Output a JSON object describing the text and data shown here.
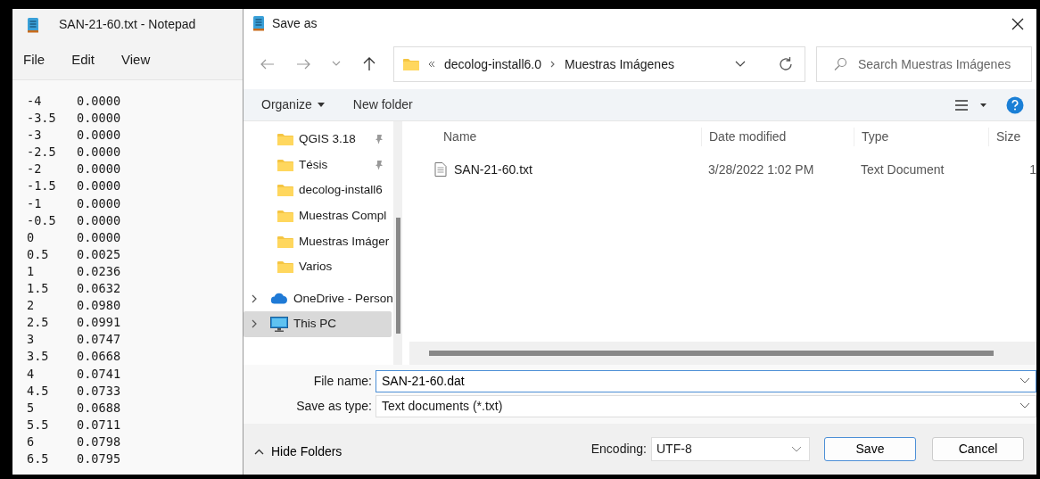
{
  "notepad": {
    "title": "SAN-21-60.txt - Notepad",
    "menu": [
      "File",
      "Edit",
      "View"
    ],
    "lines": [
      [
        "-4",
        "0.0000"
      ],
      [
        "-3.5",
        "0.0000"
      ],
      [
        "-3",
        "0.0000"
      ],
      [
        "-2.5",
        "0.0000"
      ],
      [
        "-2",
        "0.0000"
      ],
      [
        "-1.5",
        "0.0000"
      ],
      [
        "-1",
        "0.0000"
      ],
      [
        "-0.5",
        "0.0000"
      ],
      [
        "0",
        "0.0000"
      ],
      [
        "0.5",
        "0.0025"
      ],
      [
        "1",
        "0.0236"
      ],
      [
        "1.5",
        "0.0632"
      ],
      [
        "2",
        "0.0980"
      ],
      [
        "2.5",
        "0.0991"
      ],
      [
        "3",
        "0.0747"
      ],
      [
        "3.5",
        "0.0668"
      ],
      [
        "4",
        "0.0741"
      ],
      [
        "4.5",
        "0.0733"
      ],
      [
        "5",
        "0.0688"
      ],
      [
        "5.5",
        "0.0711"
      ],
      [
        "6",
        "0.0798"
      ],
      [
        "6.5",
        "0.0795"
      ]
    ]
  },
  "dialog": {
    "title": "Save as",
    "breadcrumb": [
      "decolog-install6.0",
      "Muestras Imágenes"
    ],
    "search": {
      "placeholder": "Search Muestras Imágenes"
    },
    "toolbar": {
      "organize": "Organize",
      "new_folder": "New folder"
    },
    "nav_items": [
      {
        "label": "QGIS 3.18",
        "kind": "folder",
        "pinned": true,
        "expandable": false,
        "selected": false
      },
      {
        "label": "Tésis",
        "kind": "folder",
        "pinned": true,
        "expandable": false,
        "selected": false
      },
      {
        "label": "decolog-install6",
        "kind": "folder",
        "pinned": false,
        "expandable": false,
        "selected": false
      },
      {
        "label": "Muestras Compl",
        "kind": "folder",
        "pinned": false,
        "expandable": false,
        "selected": false
      },
      {
        "label": "Muestras Imáger",
        "kind": "folder",
        "pinned": false,
        "expandable": false,
        "selected": false
      },
      {
        "label": "Varios",
        "kind": "folder",
        "pinned": false,
        "expandable": false,
        "selected": false
      },
      {
        "label": "OneDrive - Person",
        "kind": "cloud",
        "pinned": false,
        "expandable": true,
        "selected": false
      },
      {
        "label": "This PC",
        "kind": "pc",
        "pinned": false,
        "expandable": true,
        "selected": true
      }
    ],
    "columns": [
      "Name",
      "Date modified",
      "Type",
      "Size"
    ],
    "rows": [
      {
        "name": "SAN-21-60.txt",
        "date": "3/28/2022 1:02 PM",
        "type": "Text Document",
        "size": "1"
      }
    ],
    "file_name": {
      "label": "File name:",
      "value": "SAN-21-60.dat"
    },
    "save_type": {
      "label": "Save as type:",
      "value": "Text documents (*.txt)"
    },
    "hide_folders": "Hide Folders",
    "encoding": {
      "label": "Encoding:",
      "value": "UTF-8"
    },
    "buttons": [
      "Save",
      "Cancel"
    ]
  }
}
